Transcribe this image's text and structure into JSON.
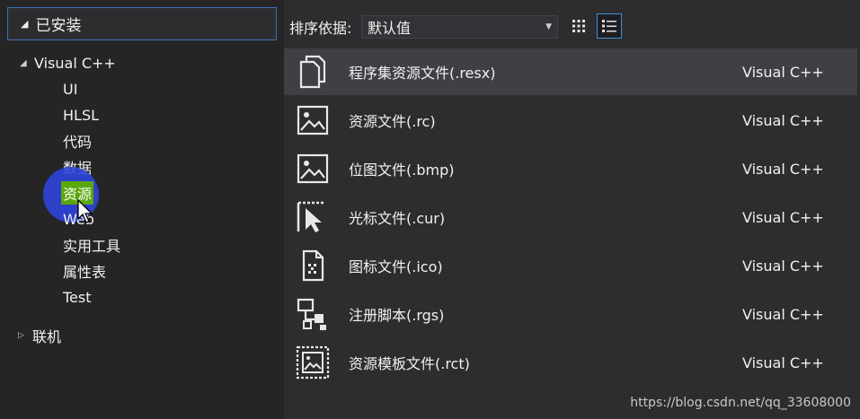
{
  "left_panel": {
    "installed_label": "已安装",
    "tree": [
      {
        "label": "Visual C++",
        "expanded": true,
        "level": 0
      },
      {
        "label": "UI",
        "level": 1
      },
      {
        "label": "HLSL",
        "level": 1
      },
      {
        "label": "代码",
        "level": 1
      },
      {
        "label": "数据",
        "level": 1
      },
      {
        "label": "资源",
        "level": 1,
        "selected": true
      },
      {
        "label": "Web",
        "level": 1
      },
      {
        "label": "实用工具",
        "level": 1
      },
      {
        "label": "属性表",
        "level": 1
      },
      {
        "label": "Test",
        "level": 1
      },
      {
        "label": "联机",
        "expanded": false,
        "level": 0
      }
    ]
  },
  "toolbar": {
    "sort_label": "排序依据:",
    "sort_value": "默认值"
  },
  "templates": [
    {
      "name": "程序集资源文件(.resx)",
      "lang": "Visual C++",
      "icon": "resx-file-icon",
      "selected": true
    },
    {
      "name": "资源文件(.rc)",
      "lang": "Visual C++",
      "icon": "image-file-icon"
    },
    {
      "name": "位图文件(.bmp)",
      "lang": "Visual C++",
      "icon": "bitmap-file-icon"
    },
    {
      "name": "光标文件(.cur)",
      "lang": "Visual C++",
      "icon": "cursor-file-icon"
    },
    {
      "name": "图标文件(.ico)",
      "lang": "Visual C++",
      "icon": "icon-file-icon"
    },
    {
      "name": "注册脚本(.rgs)",
      "lang": "Visual C++",
      "icon": "registry-script-icon"
    },
    {
      "name": "资源模板文件(.rct)",
      "lang": "Visual C++",
      "icon": "resource-template-icon"
    }
  ],
  "watermark": "https://blog.csdn.net/qq_33608000",
  "colors": {
    "background": "#2d2d30",
    "panel": "#252526",
    "selection": "#3f3f46",
    "tree_selection": "#5aa80e",
    "accent_border": "#3f8fd8",
    "cursor_halo": "#2f44e0"
  }
}
